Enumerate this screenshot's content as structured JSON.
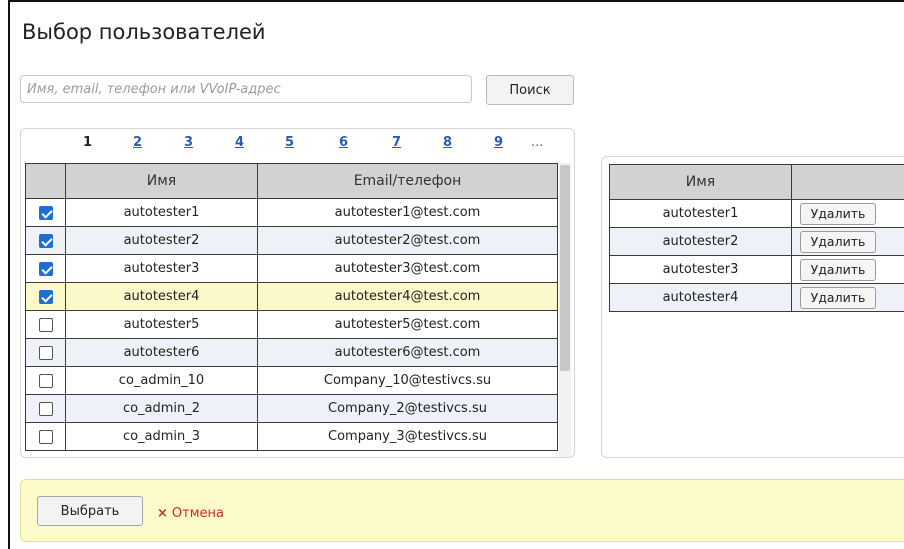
{
  "title": "Выбор пользователей",
  "search": {
    "placeholder": "Имя, email, телефон или VVoIP-адрес",
    "value": "",
    "button_label": "Поиск"
  },
  "pagination": {
    "current": "1",
    "links": [
      "2",
      "3",
      "4",
      "5",
      "6",
      "7",
      "8",
      "9"
    ],
    "more": "..."
  },
  "users_table": {
    "columns": [
      "Имя",
      "Email/телефон"
    ],
    "rows": [
      {
        "name": "autotester1",
        "contact": "autotester1@test.com",
        "checked": true
      },
      {
        "name": "autotester2",
        "contact": "autotester2@test.com",
        "checked": true
      },
      {
        "name": "autotester3",
        "contact": "autotester3@test.com",
        "checked": true
      },
      {
        "name": "autotester4",
        "contact": "autotester4@test.com",
        "checked": true,
        "highlighted": true
      },
      {
        "name": "autotester5",
        "contact": "autotester5@test.com",
        "checked": false
      },
      {
        "name": "autotester6",
        "contact": "autotester6@test.com",
        "checked": false
      },
      {
        "name": "co_admin_10",
        "contact": "Company_10@testivcs.su",
        "checked": false
      },
      {
        "name": "co_admin_2",
        "contact": "Company_2@testivcs.su",
        "checked": false
      },
      {
        "name": "co_admin_3",
        "contact": "Company_3@testivcs.su",
        "checked": false
      }
    ]
  },
  "selected_table": {
    "columns": [
      "Имя",
      ""
    ],
    "delete_label": "Удалить",
    "rows": [
      {
        "name": "autotester1"
      },
      {
        "name": "autotester2"
      },
      {
        "name": "autotester3"
      },
      {
        "name": "autotester4"
      }
    ]
  },
  "footer": {
    "select_label": "Выбрать",
    "cancel_icon": "×",
    "cancel_label": "Отмена"
  },
  "colors": {
    "checkbox_checked": "#1d6fd6",
    "row_alt": "#eef2f8",
    "row_highlight": "#fbf8c9",
    "footer_bg": "#fdfbc9",
    "cancel_text": "#cc2a2a",
    "link": "#2a5db0"
  }
}
